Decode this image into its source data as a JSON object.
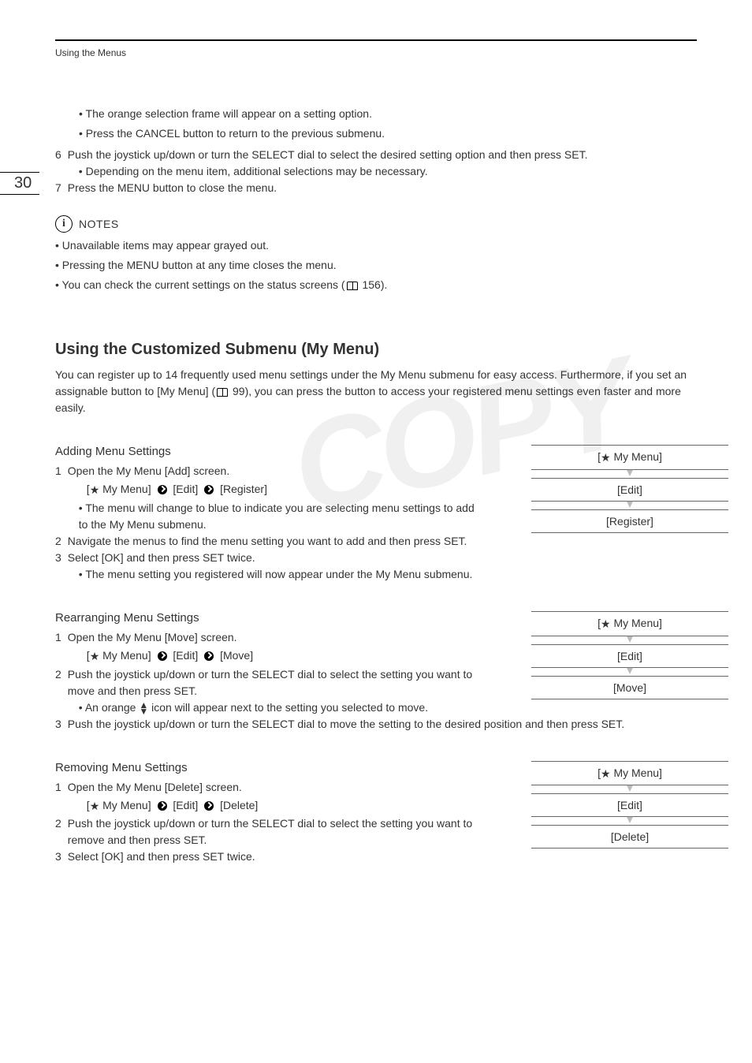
{
  "running_head": "Using the Menus",
  "page_number": "30",
  "intro_bullets": [
    "The orange selection frame will appear on a setting option.",
    "Press the CANCEL button to return to the previous submenu."
  ],
  "step6": {
    "num": "6",
    "text": "Push the joystick up/down or turn the SELECT dial to select the desired setting option and then press SET.",
    "bullet": "Depending on the menu item, additional selections may be necessary."
  },
  "step7": {
    "num": "7",
    "text": "Press the MENU button to close the menu."
  },
  "notes_label": "NOTES",
  "notes": {
    "n1": "Unavailable items may appear grayed out.",
    "n2": "Pressing the MENU button at any time closes the menu.",
    "n3_pre": "You can check the current settings on the status screens (",
    "n3_ref": " 156)."
  },
  "section_title": "Using the Customized Submenu (My Menu)",
  "section_intro_pre": "You can register up to 14 frequently used menu settings under the My Menu submenu for easy access. Furthermore, if you set an assignable button to [My Menu] (",
  "section_intro_ref": " 99), you can press the button to access your registered menu settings even faster and more easily.",
  "adding": {
    "title": "Adding Menu Settings",
    "s1": {
      "num": "1",
      "text": "Open the My Menu [Add] screen."
    },
    "path_parts": {
      "p1": "My Menu]",
      "p2": "[Edit]",
      "p3": "[Register]"
    },
    "path_sub": "The menu will change to blue to indicate you are selecting menu settings to add to the My Menu submenu.",
    "s2": {
      "num": "2",
      "text": "Navigate the menus to find the menu setting you want to add and then press SET."
    },
    "s3": {
      "num": "3",
      "text": "Select [OK] and then press SET twice."
    },
    "s3_sub": "The menu setting you registered will now appear under the My Menu submenu.",
    "nav": {
      "r1": "My Menu]",
      "r2": "[Edit]",
      "r3": "[Register]"
    }
  },
  "rearranging": {
    "title": "Rearranging Menu Settings",
    "s1": {
      "num": "1",
      "text": "Open the My Menu [Move] screen."
    },
    "path_parts": {
      "p1": "My Menu]",
      "p2": "[Edit]",
      "p3": "[Move]"
    },
    "s2": {
      "num": "2",
      "text": "Push the joystick up/down or turn the SELECT dial to select the setting you want to move and then press SET."
    },
    "s2_sub_pre": "An orange ",
    "s2_sub_post": " icon will appear next to the setting you selected to move.",
    "s3": {
      "num": "3",
      "text": "Push the joystick up/down or turn the SELECT dial to move the setting to the desired position and then press SET."
    },
    "nav": {
      "r1": "My Menu]",
      "r2": "[Edit]",
      "r3": "[Move]"
    }
  },
  "removing": {
    "title": "Removing Menu Settings",
    "s1": {
      "num": "1",
      "text": "Open the My Menu [Delete] screen."
    },
    "path_parts": {
      "p1": "My Menu]",
      "p2": "[Edit]",
      "p3": "[Delete]"
    },
    "s2": {
      "num": "2",
      "text": "Push the joystick up/down or turn the SELECT dial to select the setting you want to remove and then press SET."
    },
    "s3": {
      "num": "3",
      "text": "Select [OK] and then press SET twice."
    },
    "nav": {
      "r1": "My Menu]",
      "r2": "[Edit]",
      "r3": "[Delete]"
    }
  },
  "watermark": "COPY"
}
